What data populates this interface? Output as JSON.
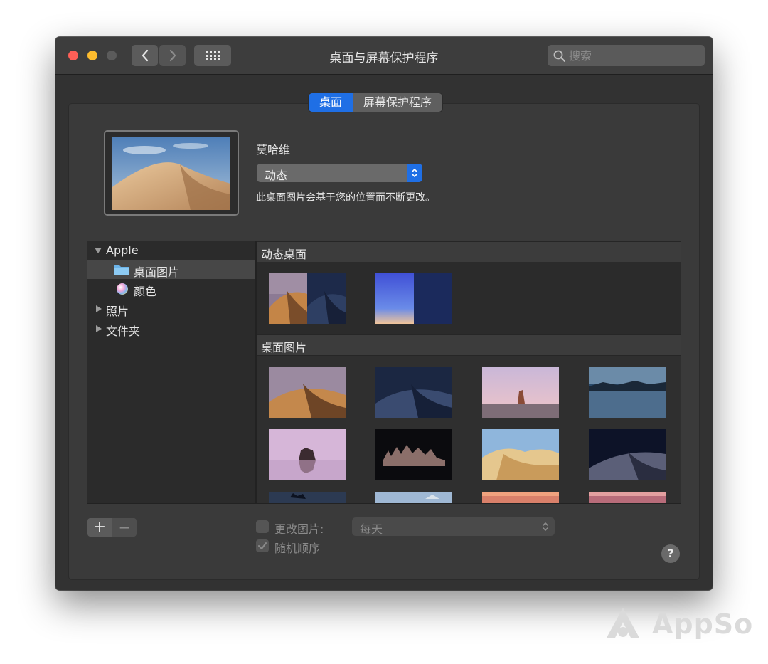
{
  "window": {
    "title": "桌面与屏幕保护程序"
  },
  "search": {
    "placeholder": "搜索"
  },
  "tabs": [
    {
      "label": "桌面",
      "active": true
    },
    {
      "label": "屏幕保护程序",
      "active": false
    }
  ],
  "current": {
    "name": "莫哈维",
    "mode_value": "动态",
    "description": "此桌面图片会基于您的位置而不断更改。"
  },
  "sources": {
    "apple": "Apple",
    "desktop_pictures": "桌面图片",
    "colors": "颜色",
    "photos": "照片",
    "folders": "文件夹"
  },
  "sections": {
    "dynamic": "动态桌面",
    "pictures": "桌面图片"
  },
  "controls": {
    "add": "+",
    "remove": "−",
    "change_picture_label": "更改图片:",
    "change_picture_checked": false,
    "interval_value": "每天",
    "random_order_label": "随机顺序",
    "random_order_checked": true,
    "help": "?"
  },
  "watermark": "AppSo",
  "colors": {
    "accent": "#1f6fe5",
    "close": "#ff5f57",
    "minimize": "#febc2e"
  }
}
